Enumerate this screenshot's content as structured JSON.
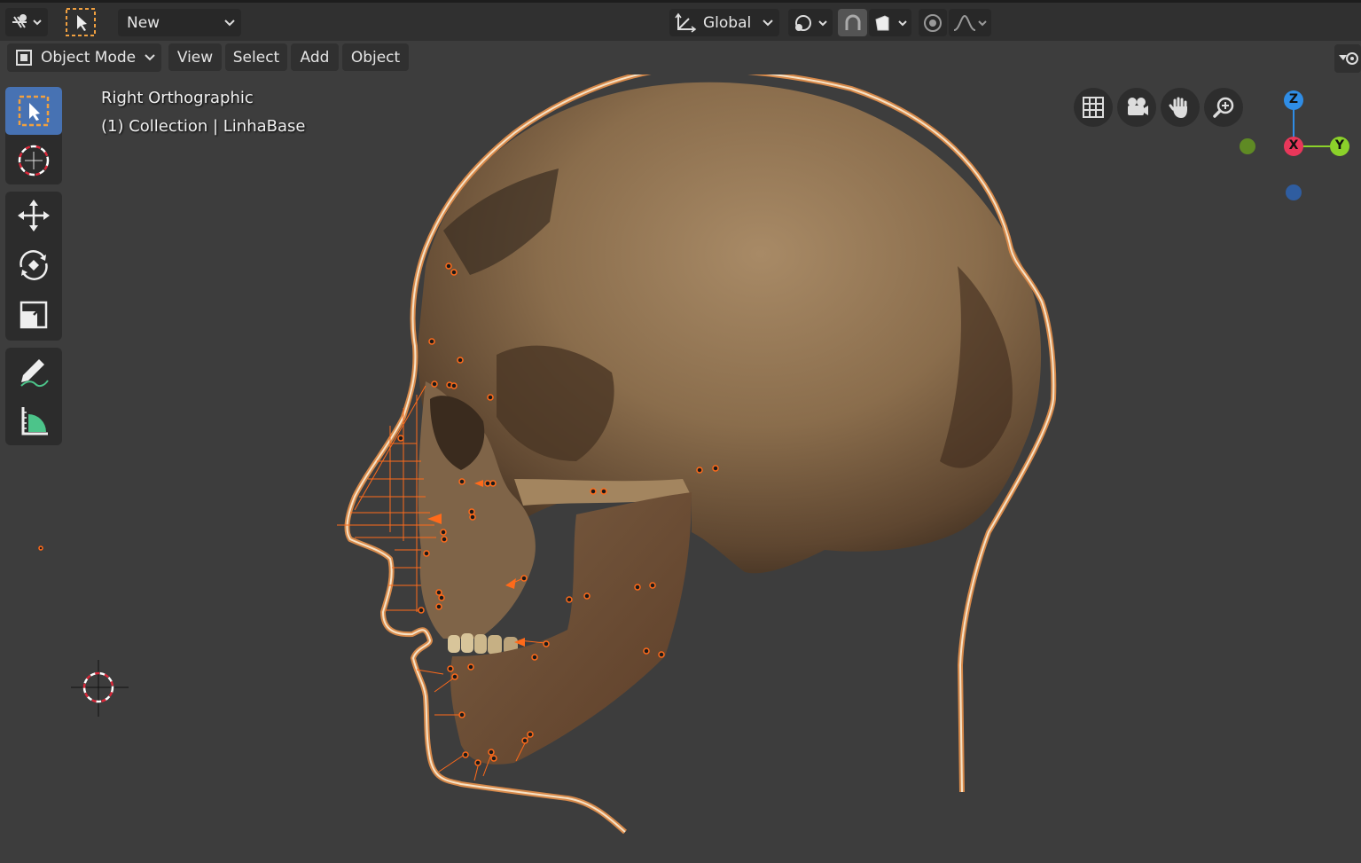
{
  "topbar": {
    "editor_type": "object-mode-editor-icon",
    "brush_name": "New",
    "transform_orientation": "Global"
  },
  "header": {
    "mode": "Object Mode",
    "menus": [
      "View",
      "Select",
      "Add",
      "Object"
    ]
  },
  "viewport": {
    "view_name": "Right Orthographic",
    "collection_info": "(1) Collection | LinhaBase"
  },
  "gizmo": {
    "z_label": "Z",
    "x_label": "X",
    "y_label": "Y",
    "colors": {
      "x": "#e8375a",
      "y": "#8bd12a",
      "z": "#2f8de6",
      "neg_y": "#5f8a24",
      "neg_x": "#2f5da0"
    }
  },
  "tools": [
    "select-box-icon",
    "cursor-icon",
    "move-icon",
    "rotate-icon",
    "scale-icon",
    "annotate-icon",
    "measure-icon"
  ],
  "colors": {
    "accent": "#4772b3",
    "selection_outline": "#f0a060",
    "highlight": "#ff6a1a"
  }
}
